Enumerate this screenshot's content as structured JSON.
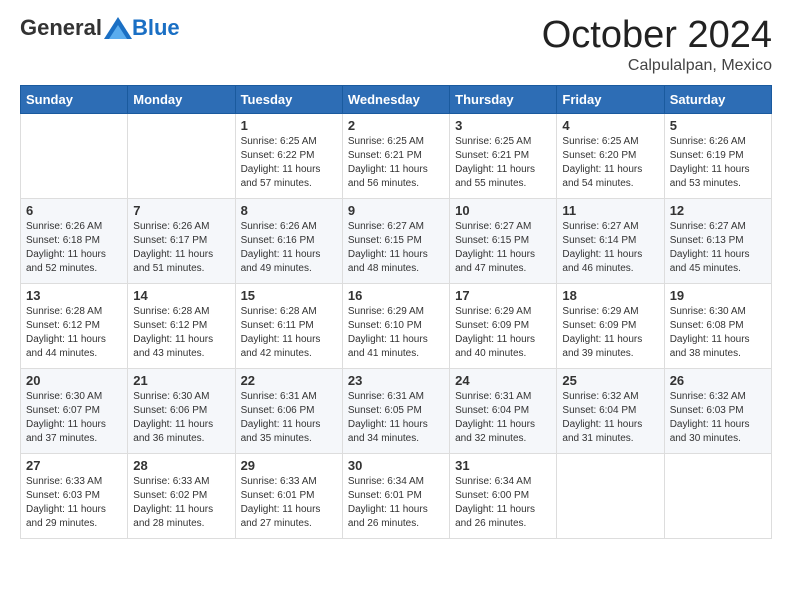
{
  "header": {
    "logo_general": "General",
    "logo_blue": "Blue",
    "month": "October 2024",
    "location": "Calpulalpan, Mexico"
  },
  "days_of_week": [
    "Sunday",
    "Monday",
    "Tuesday",
    "Wednesday",
    "Thursday",
    "Friday",
    "Saturday"
  ],
  "weeks": [
    [
      {
        "day": "",
        "info": ""
      },
      {
        "day": "",
        "info": ""
      },
      {
        "day": "1",
        "info": "Sunrise: 6:25 AM\nSunset: 6:22 PM\nDaylight: 11 hours and 57 minutes."
      },
      {
        "day": "2",
        "info": "Sunrise: 6:25 AM\nSunset: 6:21 PM\nDaylight: 11 hours and 56 minutes."
      },
      {
        "day": "3",
        "info": "Sunrise: 6:25 AM\nSunset: 6:21 PM\nDaylight: 11 hours and 55 minutes."
      },
      {
        "day": "4",
        "info": "Sunrise: 6:25 AM\nSunset: 6:20 PM\nDaylight: 11 hours and 54 minutes."
      },
      {
        "day": "5",
        "info": "Sunrise: 6:26 AM\nSunset: 6:19 PM\nDaylight: 11 hours and 53 minutes."
      }
    ],
    [
      {
        "day": "6",
        "info": "Sunrise: 6:26 AM\nSunset: 6:18 PM\nDaylight: 11 hours and 52 minutes."
      },
      {
        "day": "7",
        "info": "Sunrise: 6:26 AM\nSunset: 6:17 PM\nDaylight: 11 hours and 51 minutes."
      },
      {
        "day": "8",
        "info": "Sunrise: 6:26 AM\nSunset: 6:16 PM\nDaylight: 11 hours and 49 minutes."
      },
      {
        "day": "9",
        "info": "Sunrise: 6:27 AM\nSunset: 6:15 PM\nDaylight: 11 hours and 48 minutes."
      },
      {
        "day": "10",
        "info": "Sunrise: 6:27 AM\nSunset: 6:15 PM\nDaylight: 11 hours and 47 minutes."
      },
      {
        "day": "11",
        "info": "Sunrise: 6:27 AM\nSunset: 6:14 PM\nDaylight: 11 hours and 46 minutes."
      },
      {
        "day": "12",
        "info": "Sunrise: 6:27 AM\nSunset: 6:13 PM\nDaylight: 11 hours and 45 minutes."
      }
    ],
    [
      {
        "day": "13",
        "info": "Sunrise: 6:28 AM\nSunset: 6:12 PM\nDaylight: 11 hours and 44 minutes."
      },
      {
        "day": "14",
        "info": "Sunrise: 6:28 AM\nSunset: 6:12 PM\nDaylight: 11 hours and 43 minutes."
      },
      {
        "day": "15",
        "info": "Sunrise: 6:28 AM\nSunset: 6:11 PM\nDaylight: 11 hours and 42 minutes."
      },
      {
        "day": "16",
        "info": "Sunrise: 6:29 AM\nSunset: 6:10 PM\nDaylight: 11 hours and 41 minutes."
      },
      {
        "day": "17",
        "info": "Sunrise: 6:29 AM\nSunset: 6:09 PM\nDaylight: 11 hours and 40 minutes."
      },
      {
        "day": "18",
        "info": "Sunrise: 6:29 AM\nSunset: 6:09 PM\nDaylight: 11 hours and 39 minutes."
      },
      {
        "day": "19",
        "info": "Sunrise: 6:30 AM\nSunset: 6:08 PM\nDaylight: 11 hours and 38 minutes."
      }
    ],
    [
      {
        "day": "20",
        "info": "Sunrise: 6:30 AM\nSunset: 6:07 PM\nDaylight: 11 hours and 37 minutes."
      },
      {
        "day": "21",
        "info": "Sunrise: 6:30 AM\nSunset: 6:06 PM\nDaylight: 11 hours and 36 minutes."
      },
      {
        "day": "22",
        "info": "Sunrise: 6:31 AM\nSunset: 6:06 PM\nDaylight: 11 hours and 35 minutes."
      },
      {
        "day": "23",
        "info": "Sunrise: 6:31 AM\nSunset: 6:05 PM\nDaylight: 11 hours and 34 minutes."
      },
      {
        "day": "24",
        "info": "Sunrise: 6:31 AM\nSunset: 6:04 PM\nDaylight: 11 hours and 32 minutes."
      },
      {
        "day": "25",
        "info": "Sunrise: 6:32 AM\nSunset: 6:04 PM\nDaylight: 11 hours and 31 minutes."
      },
      {
        "day": "26",
        "info": "Sunrise: 6:32 AM\nSunset: 6:03 PM\nDaylight: 11 hours and 30 minutes."
      }
    ],
    [
      {
        "day": "27",
        "info": "Sunrise: 6:33 AM\nSunset: 6:03 PM\nDaylight: 11 hours and 29 minutes."
      },
      {
        "day": "28",
        "info": "Sunrise: 6:33 AM\nSunset: 6:02 PM\nDaylight: 11 hours and 28 minutes."
      },
      {
        "day": "29",
        "info": "Sunrise: 6:33 AM\nSunset: 6:01 PM\nDaylight: 11 hours and 27 minutes."
      },
      {
        "day": "30",
        "info": "Sunrise: 6:34 AM\nSunset: 6:01 PM\nDaylight: 11 hours and 26 minutes."
      },
      {
        "day": "31",
        "info": "Sunrise: 6:34 AM\nSunset: 6:00 PM\nDaylight: 11 hours and 26 minutes."
      },
      {
        "day": "",
        "info": ""
      },
      {
        "day": "",
        "info": ""
      }
    ]
  ]
}
